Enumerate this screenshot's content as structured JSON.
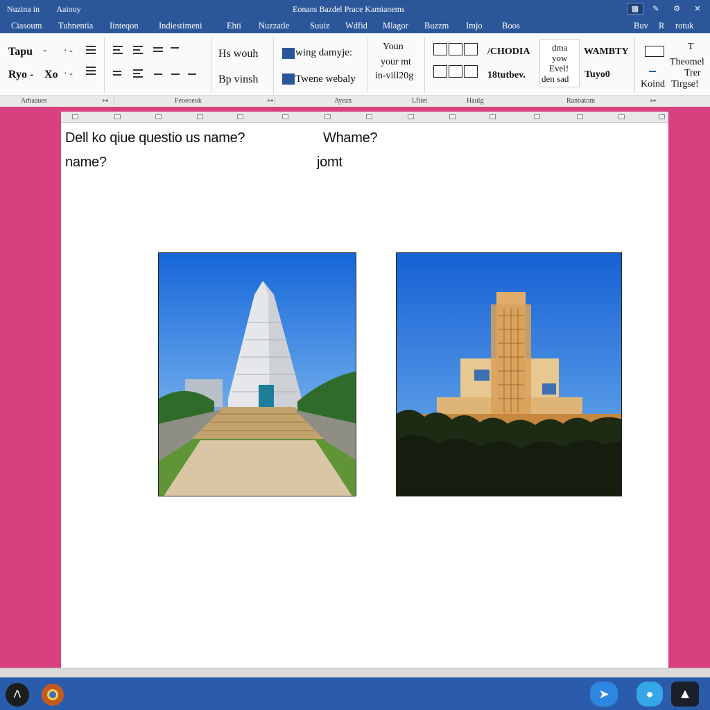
{
  "window": {
    "title": "Eonans Bazdel Prace Kamianems",
    "left_items": [
      "Nuzina in",
      "Aaiooy"
    ],
    "controls": [
      "minimize-icon",
      "pen-icon",
      "settings-icon",
      "close-icon"
    ]
  },
  "menu": {
    "tabs": [
      "Ciasoum",
      "Tuhnentia",
      "Iinteqon",
      "Indiestimeni",
      "Ehti",
      "Nuzzatle",
      "Suuiz",
      "Wdfid",
      "Mlagor",
      "Buzzm",
      "Imjo",
      "Boos"
    ],
    "right_items": [
      "Buv",
      "R",
      "rotuk"
    ]
  },
  "ribbon": {
    "font_row1_a": "Tapu",
    "font_row1_b": "-",
    "font_row2_a": "Ryo -",
    "font_row2_b": "Xo",
    "style_a": "Hs wouh",
    "style_b": "Bp vinsh",
    "insert_a": "wing damyje:",
    "insert_b": "Twene webaly",
    "block_lines": [
      "Youn",
      "your mt",
      "in-vill20g"
    ],
    "layout_a": "/CHODIA",
    "layout_b": "18tutbev.",
    "style_card_lines": [
      "dma",
      "yow",
      "Evel!",
      "den sad"
    ],
    "wordart_a": "WAMBTY",
    "wordart_b": "Tuyo0",
    "right_a": "Theomel",
    "right_b": "Trer",
    "right_c": "Tirgse!",
    "right_d": "Koind"
  },
  "groups": {
    "labels": [
      "Arbaaues",
      "Feoeoeok",
      "Ayezn",
      "Lfiiet",
      "Haulg",
      "Ranoatom"
    ]
  },
  "document": {
    "line1_left": "Dell ko qiue questio us name?",
    "line1_right": "Whame?",
    "line2_left": "name?",
    "line2_right": "jomt"
  },
  "taskbar": {
    "icons": [
      "start-icon",
      "browser-icon",
      "chat-icon",
      "messenger-icon",
      "send-icon"
    ]
  }
}
